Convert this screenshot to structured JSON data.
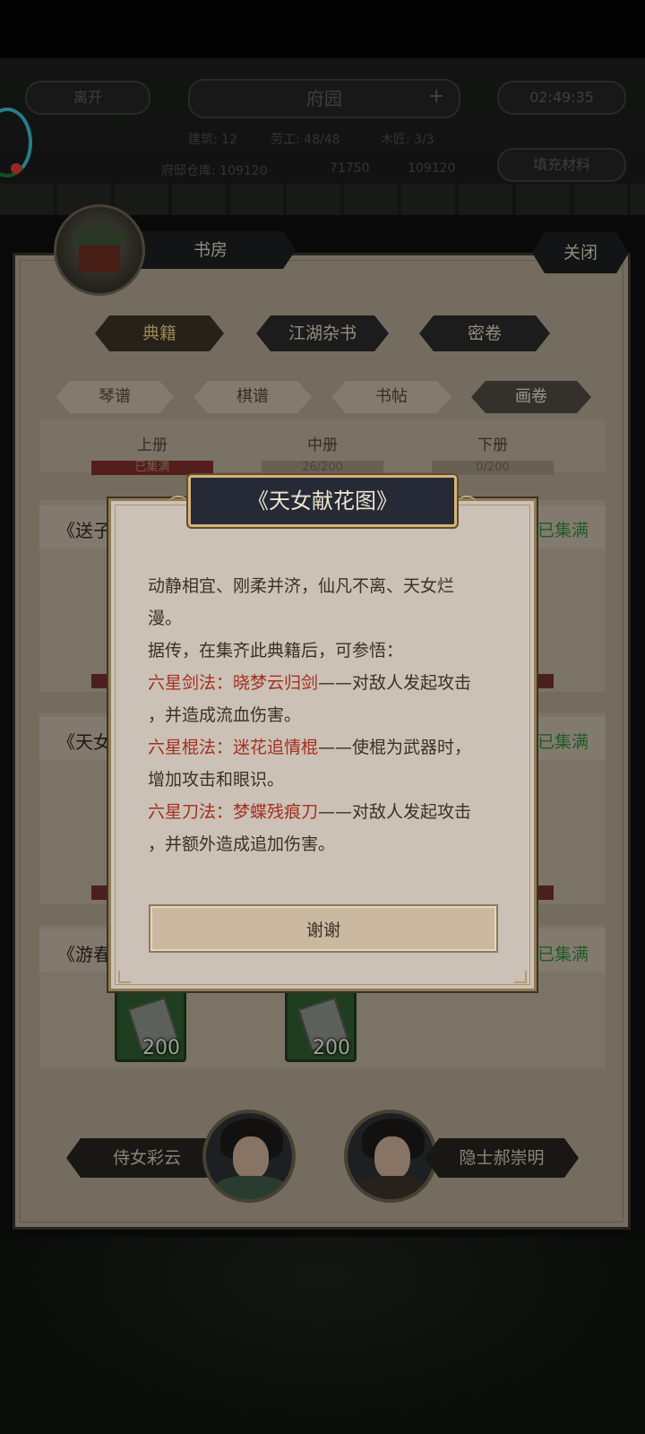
{
  "hud": {
    "leave": "离开",
    "title": "府园",
    "plus": "+",
    "time": "02:49:35",
    "stats_row1": [
      "建筑: 12",
      "劳工: 48/48",
      "木匠: 3/3"
    ],
    "stats_row2": [
      "府邸仓库: 109120",
      "71750",
      "109120"
    ],
    "fill_materials": "填充材料"
  },
  "panel": {
    "room": "书房",
    "close": "关闭",
    "tabs": [
      "典籍",
      "江湖杂书",
      "密卷"
    ],
    "subtabs": [
      "琴谱",
      "棋谱",
      "书帖",
      "画卷"
    ],
    "volumes": [
      {
        "label": "上册",
        "progress": "已集满"
      },
      {
        "label": "中册",
        "progress": "26/200"
      },
      {
        "label": "下册",
        "progress": "0/200"
      }
    ],
    "cards": [
      {
        "title": "《送子",
        "status": "已集满"
      },
      {
        "title": "《天女",
        "status": "已集满"
      },
      {
        "title": "《游春",
        "status": "已集满"
      }
    ],
    "items": [
      {
        "count": "200"
      },
      {
        "count": "200"
      }
    ],
    "npcs": [
      {
        "name": "侍女彩云"
      },
      {
        "name": "隐士郝崇明"
      }
    ]
  },
  "dialog": {
    "title": "《天女献花图》",
    "line1": "动静相宜、刚柔并济，仙凡不离、天女烂",
    "line2": "漫。",
    "line3": "据传，在集齐此典籍后，可参悟：",
    "skills": [
      {
        "name": "六星剑法：晓梦云归剑",
        "effect": "——对敌人发起攻击",
        "effect2": "，并造成流血伤害。"
      },
      {
        "name": "六星棍法：迷花追情棍",
        "effect": "——使棍为武器时，",
        "effect2": "增加攻击和眼识。"
      },
      {
        "name": "六星刀法：梦蝶残痕刀",
        "effect": "——对敌人发起攻击",
        "effect2": "，并额外造成追加伤害。"
      }
    ],
    "thanks": "谢谢"
  },
  "colors": {
    "accent_red": "#a4301f",
    "full_green": "#2f8a3a",
    "gold_border": "#d4b47a"
  }
}
